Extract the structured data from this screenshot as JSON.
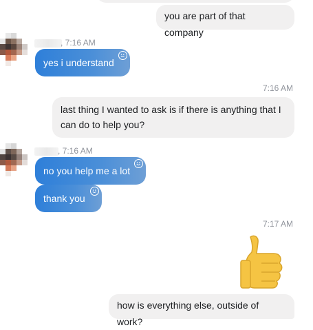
{
  "messages": {
    "m1": {
      "text": "you are part of that company"
    },
    "group1": {
      "time": ", 7:16 AM",
      "m2": {
        "text": "yes i understand"
      }
    },
    "stamp1": "7:16 AM",
    "m3": {
      "text": "last thing I wanted to ask is if there is anything that I can do to help you?"
    },
    "group2": {
      "time": ", 7:16 AM",
      "m4": {
        "text": "no you help me a lot"
      },
      "m5": {
        "text": "thank you"
      }
    },
    "stamp2": "7:17 AM",
    "m6": {
      "emoji": "👍",
      "icon": "thumbs-up-icon"
    },
    "m7": {
      "text": "how is everything else, outside of work?"
    }
  },
  "colors": {
    "outgoing_bubble": "#f1f0f0",
    "incoming_bubble_start": "#2e7fd9",
    "incoming_bubble_end": "#6e9fd6",
    "timestamp": "#90949c",
    "thumb": "#f5c443"
  }
}
